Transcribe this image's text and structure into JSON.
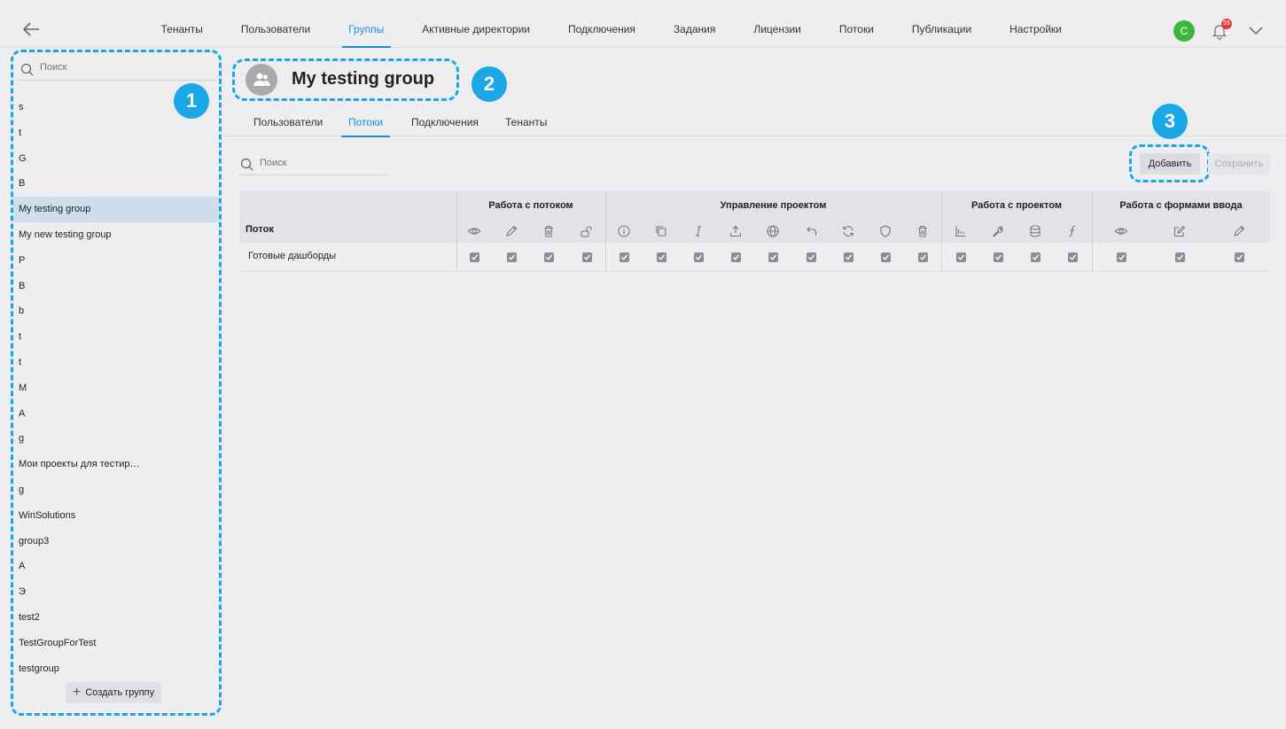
{
  "nav": {
    "items": [
      "Тенанты",
      "Пользователи",
      "Группы",
      "Активные директории",
      "Подключения",
      "Задания",
      "Лицензии",
      "Потоки",
      "Публикации",
      "Настройки"
    ],
    "active_index": 2,
    "user_initial": "С",
    "notification_count": "55",
    "icons": [
      "back-arrow-icon",
      "bell-icon",
      "chevron-down-icon"
    ]
  },
  "sidebar": {
    "search_placeholder": "Поиск",
    "groups": [
      "s",
      "t",
      "G",
      "B",
      "My testing group",
      "My new testing group",
      "P",
      "B",
      "b",
      "t",
      "t",
      "M",
      "A",
      "g",
      "Мои проекты для тестир…",
      "g",
      "WinSolutions",
      "group3",
      "A",
      "Э",
      "test2",
      "TestGroupForTest",
      "testgroup"
    ],
    "selected_index": 4,
    "create_label": "Создать группу"
  },
  "callouts": [
    "1",
    "2",
    "3"
  ],
  "group": {
    "title": "My testing group"
  },
  "subtabs": {
    "items": [
      "Пользователи",
      "Потоки",
      "Подключения",
      "Тенанты"
    ],
    "active_index": 1
  },
  "content": {
    "search_placeholder": "Поиск",
    "add_label": "Добавить",
    "save_label": "Сохранить"
  },
  "table": {
    "first_col_header": "Поток",
    "groups": [
      {
        "title": "Работа с потоком",
        "icons": [
          "eye-icon",
          "pencil-icon",
          "trash-icon",
          "unlock-icon"
        ]
      },
      {
        "title": "Управление проектом",
        "icons": [
          "info-icon",
          "copy-icon",
          "italic-icon",
          "upload-icon",
          "globe-icon",
          "undo-icon",
          "refresh-icon",
          "shield-icon",
          "trash-icon"
        ]
      },
      {
        "title": "Работа с проектом",
        "icons": [
          "chart-icon",
          "wrench-icon",
          "database-icon",
          "function-icon"
        ]
      },
      {
        "title": "Работа с формами ввода",
        "icons": [
          "eye-icon",
          "edit-icon",
          "pencil-icon"
        ]
      }
    ],
    "rows": [
      {
        "name": "Готовые дашборды",
        "checked": [
          true,
          true,
          true,
          true,
          true,
          true,
          true,
          true,
          true,
          true,
          true,
          true,
          true,
          true,
          true,
          true,
          true,
          true,
          true,
          true
        ]
      }
    ]
  }
}
